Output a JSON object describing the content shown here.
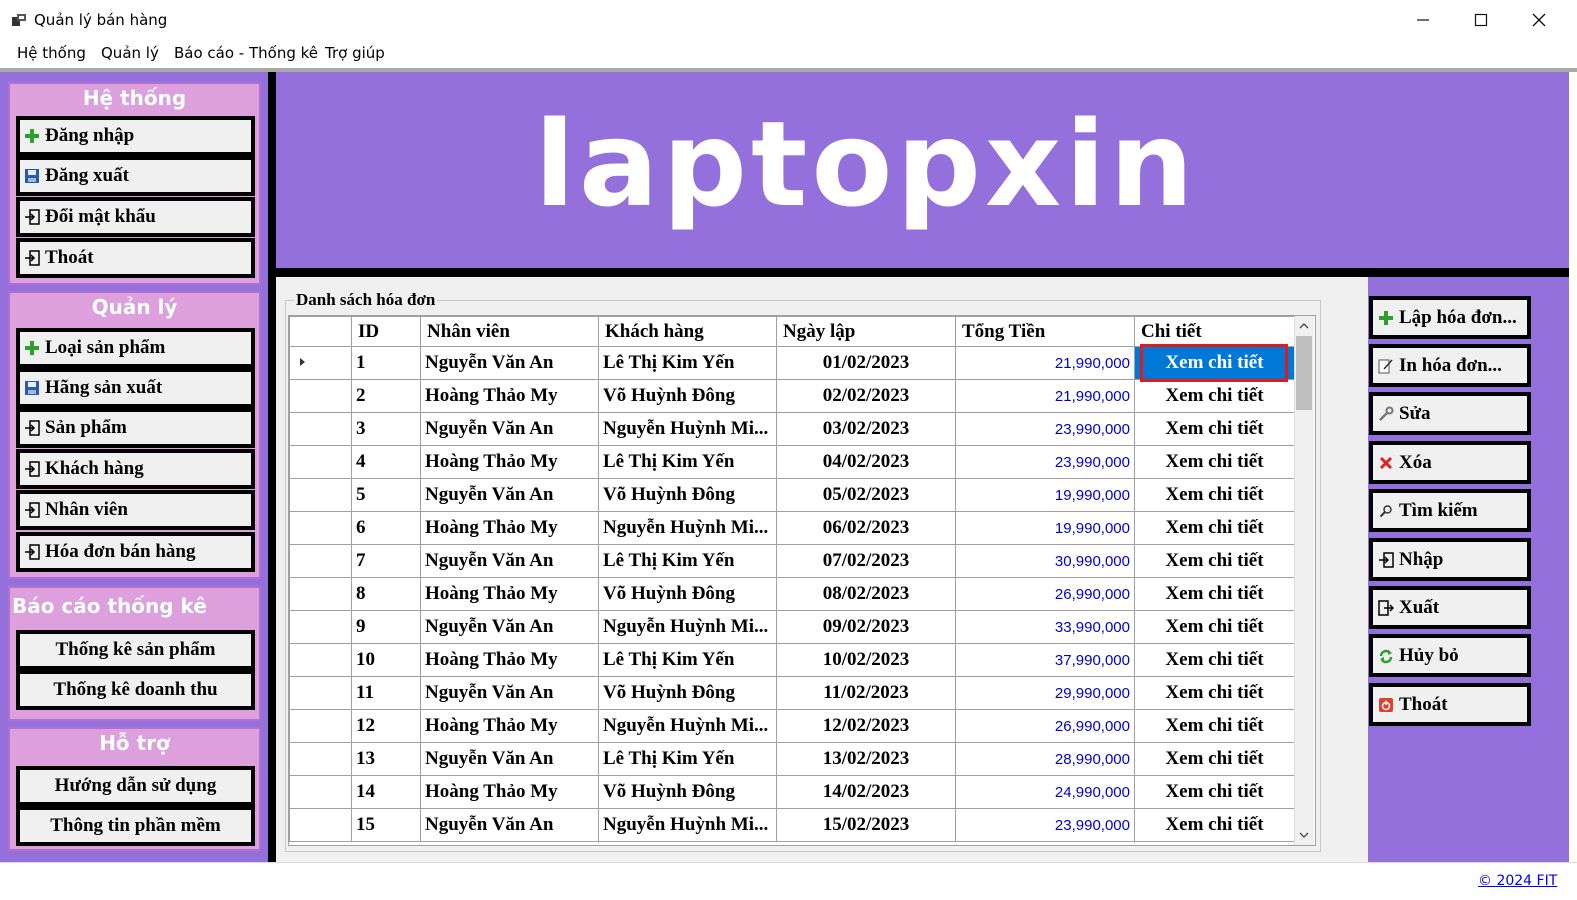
{
  "window": {
    "title": "Quản lý bán hàng"
  },
  "menu": [
    "Hệ thống",
    "Quản lý",
    "Báo cáo - Thống kê",
    "Trợ giúp"
  ],
  "sidebar": {
    "system": {
      "title": "Hệ thống",
      "items": [
        "Đăng nhập",
        "Đăng xuất",
        "Đổi mật khẩu",
        "Thoát"
      ]
    },
    "manage": {
      "title": "Quản lý",
      "items": [
        "Loại sản phẩm",
        "Hãng sản xuất",
        "Sản phẩm",
        "Khách hàng",
        "Nhân viên",
        "Hóa đơn bán hàng"
      ]
    },
    "report": {
      "title": "Báo cáo thống kê",
      "items": [
        "Thống kê sản phẩm",
        "Thống kê doanh thu"
      ]
    },
    "support": {
      "title": "Hỗ trợ",
      "items": [
        "Hướng dẫn sử dụng",
        "Thông tin phần mềm"
      ]
    }
  },
  "header": {
    "logo": "laptopxin"
  },
  "invoices": {
    "title": "Danh sách hóa đơn",
    "columns": [
      "ID",
      "Nhân viên",
      "Khách hàng",
      "Ngày lập",
      "Tổng Tiền",
      "Chi tiết"
    ],
    "rows": [
      [
        "1",
        "Nguyễn Văn An",
        "Lê Thị Kim Yến",
        "01/02/2023",
        "21,990,000",
        "Xem chi tiết"
      ],
      [
        "2",
        "Hoàng Thảo My",
        "Võ Huỳnh Đông",
        "02/02/2023",
        "21,990,000",
        "Xem chi tiết"
      ],
      [
        "3",
        "Nguyễn Văn An",
        "Nguyễn Huỳnh Mi...",
        "03/02/2023",
        "23,990,000",
        "Xem chi tiết"
      ],
      [
        "4",
        "Hoàng Thảo My",
        "Lê Thị Kim Yến",
        "04/02/2023",
        "23,990,000",
        "Xem chi tiết"
      ],
      [
        "5",
        "Nguyễn Văn An",
        "Võ Huỳnh Đông",
        "05/02/2023",
        "19,990,000",
        "Xem chi tiết"
      ],
      [
        "6",
        "Hoàng Thảo My",
        "Nguyễn Huỳnh Mi...",
        "06/02/2023",
        "19,990,000",
        "Xem chi tiết"
      ],
      [
        "7",
        "Nguyễn Văn An",
        "Lê Thị Kim Yến",
        "07/02/2023",
        "30,990,000",
        "Xem chi tiết"
      ],
      [
        "8",
        "Hoàng Thảo My",
        "Võ Huỳnh Đông",
        "08/02/2023",
        "26,990,000",
        "Xem chi tiết"
      ],
      [
        "9",
        "Nguyễn Văn An",
        "Nguyễn Huỳnh Mi...",
        "09/02/2023",
        "33,990,000",
        "Xem chi tiết"
      ],
      [
        "10",
        "Hoàng Thảo My",
        "Lê Thị Kim Yến",
        "10/02/2023",
        "37,990,000",
        "Xem chi tiết"
      ],
      [
        "11",
        "Nguyễn Văn An",
        "Võ Huỳnh Đông",
        "11/02/2023",
        "29,990,000",
        "Xem chi tiết"
      ],
      [
        "12",
        "Hoàng Thảo My",
        "Nguyễn Huỳnh Mi...",
        "12/02/2023",
        "26,990,000",
        "Xem chi tiết"
      ],
      [
        "13",
        "Nguyễn Văn An",
        "Lê Thị Kim Yến",
        "13/02/2023",
        "28,990,000",
        "Xem chi tiết"
      ],
      [
        "14",
        "Hoàng Thảo My",
        "Võ Huỳnh Đông",
        "14/02/2023",
        "24,990,000",
        "Xem chi tiết"
      ],
      [
        "15",
        "Nguyễn Văn An",
        "Nguyễn Huỳnh Mi...",
        "15/02/2023",
        "23,990,000",
        "Xem chi tiết"
      ]
    ]
  },
  "actions": [
    {
      "label": "Lập hóa đơn...",
      "icon": "plus-icon"
    },
    {
      "label": "In hóa đơn...",
      "icon": "edit-icon"
    },
    {
      "label": "Sửa",
      "icon": "wrench-icon"
    },
    {
      "label": "Xóa",
      "icon": "delete-icon"
    },
    {
      "label": "Tìm kiếm",
      "icon": "search-icon"
    },
    {
      "label": "Nhập",
      "icon": "import-icon"
    },
    {
      "label": "Xuất",
      "icon": "export-icon"
    },
    {
      "label": "Hủy bỏ",
      "icon": "refresh-icon"
    },
    {
      "label": "Thoát",
      "icon": "exit-icon"
    }
  ],
  "footer": {
    "link": "© 2024 FIT"
  },
  "colors": {
    "accent": "#9370db",
    "panel": "#dda0dd",
    "selection": "#0078d7",
    "money": "#0000cd",
    "highlight": "#e11b1b"
  }
}
